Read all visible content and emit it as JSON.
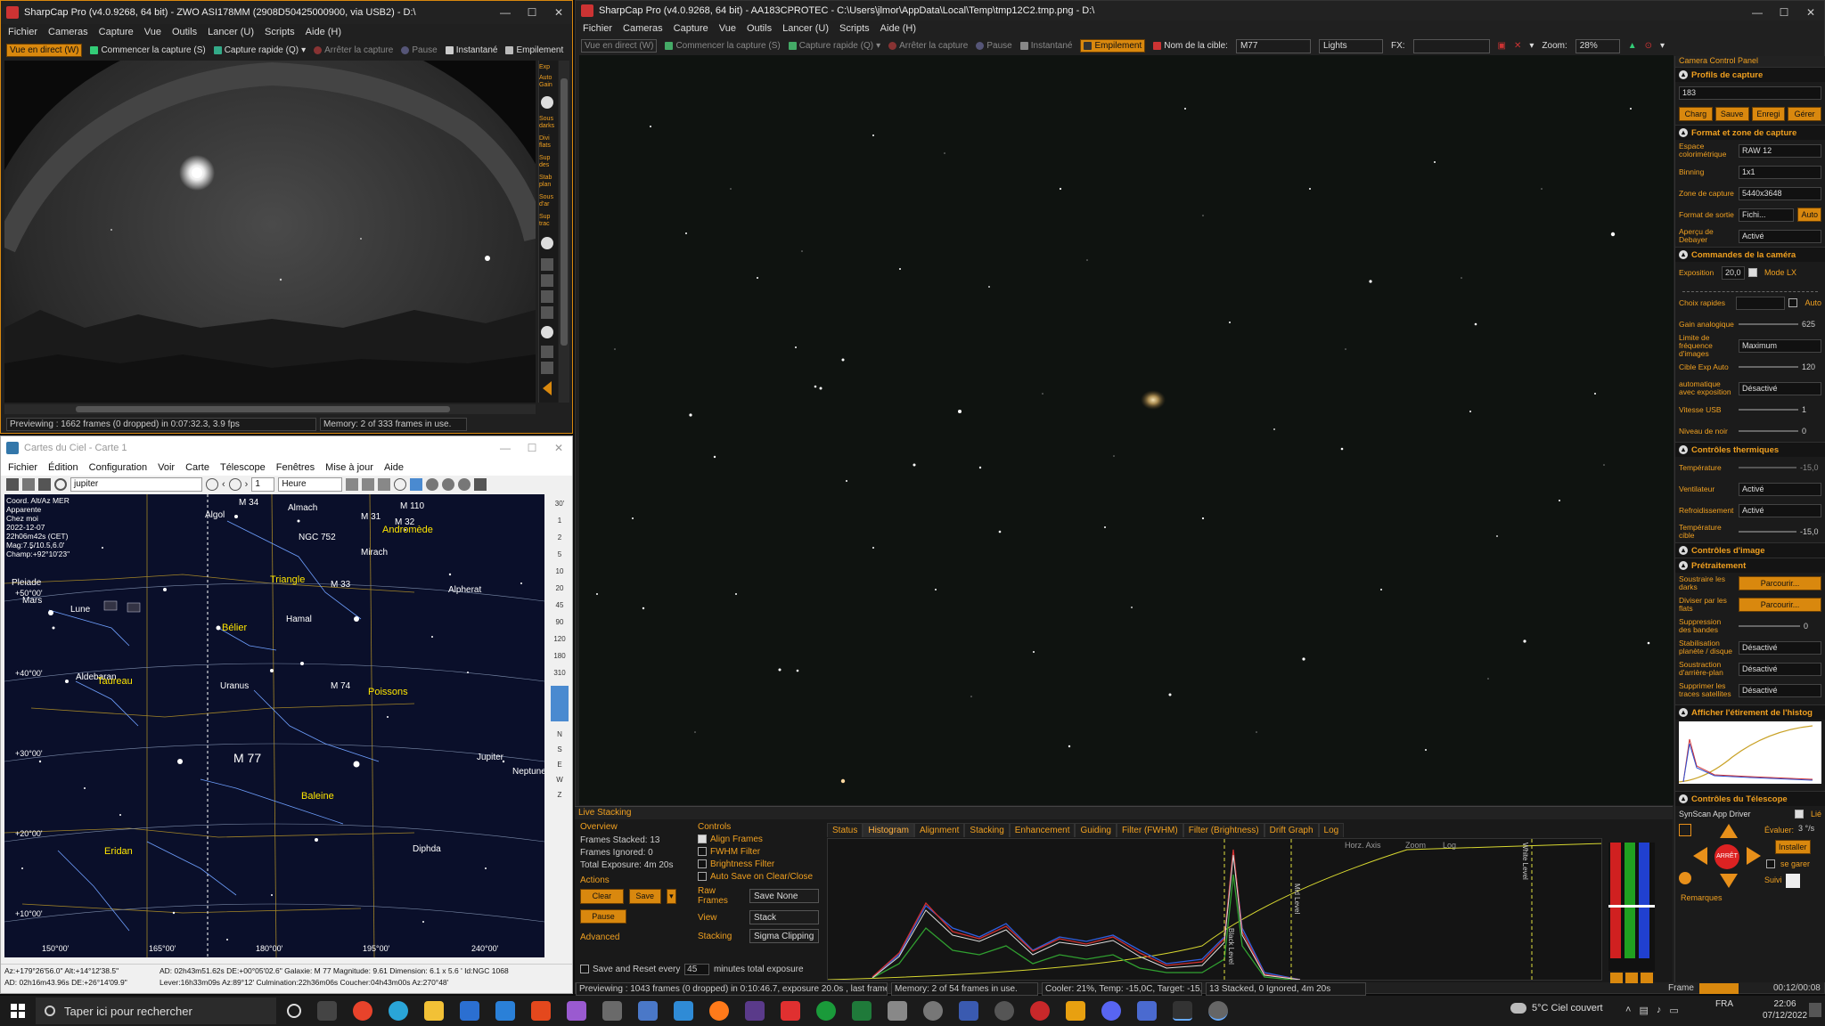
{
  "cam1": {
    "title": "SharpCap Pro (v4.0.9268, 64 bit) - ZWO ASI178MM (2908D50425000900, via USB2) - D:\\",
    "menu": [
      "Fichier",
      "Cameras",
      "Capture",
      "Vue",
      "Outils",
      "Lancer (U)",
      "Scripts",
      "Aide (H)"
    ],
    "toolbar": {
      "live": "Vue en direct (W)",
      "start": "Commencer la capture (S)",
      "quick": "Capture rapide (Q)",
      "stop": "Arrêter la capture",
      "pause": "Pause",
      "snap": "Instantané",
      "stack": "Empilement"
    },
    "side_labels": [
      "Exp",
      "Auto Gain",
      "Sous darks",
      "Divi flats",
      "Sup des",
      "Stab plan",
      "Sous d'ar",
      "Sup trac"
    ],
    "status_preview": "Previewing : 1662 frames (0 dropped) in 0:07:32.3, 3.9 fps",
    "status_memory": "Memory: 2 of 333 frames in use."
  },
  "cam2": {
    "title": "SharpCap Pro (v4.0.9268, 64 bit) - AA183CPROTEC - C:\\Users\\jlmor\\AppData\\Local\\Temp\\tmp12C2.tmp.png - D:\\",
    "menu": [
      "Fichier",
      "Cameras",
      "Capture",
      "Vue",
      "Outils",
      "Lancer (U)",
      "Scripts",
      "Aide (H)"
    ],
    "toolbar": {
      "live": "Vue en direct (W)",
      "start": "Commencer la capture (S)",
      "quick": "Capture rapide (Q)",
      "stop": "Arrêter la capture",
      "pause": "Pause",
      "snap": "Instantané",
      "stack": "Empilement",
      "target_label": "Nom de la cible:",
      "target": "M77",
      "frame_type": "Lights",
      "fx_label": "FX:",
      "zoom_label": "Zoom:",
      "zoom": "28%"
    },
    "status_preview": "Previewing : 1043 frames (0 dropped) in 0:10:46.7, exposure 20.0s , last frame 20.3",
    "status_memory": "Memory: 2 of 54 frames in use.",
    "status_cooler": "Cooler: 21%, Temp: -15,0C, Target: -15,0C",
    "status_stack": "13 Stacked, 0 Ignored, 4m 20s",
    "frame_label": "Frame",
    "frame_time": "00:12/00:08"
  },
  "panel": {
    "header": "Camera Control Panel",
    "profiles": {
      "title": "Profils de capture",
      "value": "183",
      "buttons": [
        "Charg",
        "Sauve",
        "Enregi",
        "Gérer"
      ]
    },
    "format": {
      "title": "Format et zone de capture",
      "rows": [
        {
          "label": "Espace colorimétrique",
          "value": "RAW 12"
        },
        {
          "label": "Binning",
          "value": "1x1"
        },
        {
          "label": "Zone de capture",
          "value": "5440x3648"
        },
        {
          "label": "Format de sortie",
          "value": "Fichi...",
          "extra": "Auto"
        },
        {
          "label": "Aperçu de Debayer",
          "value": "Activé"
        }
      ]
    },
    "camera": {
      "title": "Commandes de la caméra",
      "exposure_label": "Exposition",
      "exposure": "20,0",
      "mode_lx": "Mode LX",
      "quick_label": "Choix rapides",
      "auto": "Auto",
      "rows": [
        {
          "label": "Gain analogique",
          "value": "625"
        },
        {
          "label": "Limite de fréquence d'images",
          "value": "Maximum"
        },
        {
          "label": "Cible Exp Auto",
          "value": "120"
        },
        {
          "label": "automatique avec exposition",
          "value": "Désactivé"
        },
        {
          "label": "Vitesse USB",
          "value": "1"
        },
        {
          "label": "Niveau de noir",
          "value": "0"
        }
      ]
    },
    "thermal": {
      "title": "Contrôles thermiques",
      "rows": [
        {
          "label": "Température",
          "value": "-15,0"
        },
        {
          "label": "Ventilateur",
          "value": "Activé"
        },
        {
          "label": "Refroidissement",
          "value": "Activé"
        },
        {
          "label": "Température cible",
          "value": "-15,0"
        }
      ]
    },
    "image": {
      "title": "Contrôles d'image"
    },
    "preprocess": {
      "title": "Prétraitement",
      "rows": [
        {
          "label": "Soustraire les darks",
          "value": "Parcourir..."
        },
        {
          "label": "Diviser par les flats",
          "value": "Parcourir..."
        },
        {
          "label": "Suppression des bandes",
          "value": "0"
        },
        {
          "label": "Stabilisation planète / disque",
          "value": "Désactivé"
        },
        {
          "label": "Soustraction d'arrière-plan",
          "value": "Désactivé"
        },
        {
          "label": "Supprimer les traces satellites",
          "value": "Désactivé"
        }
      ]
    },
    "histo": {
      "title": "Afficher l'étirement de l'histog"
    },
    "telescope": {
      "title": "Contrôles du Télescope",
      "driver": "SynScan App Driver",
      "lie": "Lié",
      "eval_label": "Évaluer:",
      "eval": "3 °/s",
      "install": "Installer",
      "park": "se garer",
      "follow": "Suivi",
      "remarks": "Remarques",
      "stop": "ARRÊT"
    }
  },
  "live": {
    "title": "Live Stacking",
    "overview": "Overview",
    "stacked": "Frames Stacked: 13",
    "ignored": "Frames Ignored: 0",
    "total": "Total Exposure: 4m 20s",
    "actions": "Actions",
    "clear": "Clear",
    "save": "Save",
    "pause": "Pause",
    "advanced": "Advanced",
    "save_reset": "Save and Reset every",
    "minutes": "45",
    "minutes_label": "minutes total exposure",
    "controls": "Controls",
    "align": "Align Frames",
    "fwhm": "FWHM Filter",
    "bright": "Brightness Filter",
    "autosave": "Auto Save on Clear/Close",
    "raw_label": "Raw Frames",
    "raw": "Save None",
    "view_label": "View",
    "view": "Stack",
    "stacking_label": "Stacking",
    "stacking": "Sigma Clipping",
    "tabs": [
      "Status",
      "Histogram",
      "Alignment",
      "Stacking",
      "Enhancement",
      "Guiding",
      "Filter (FWHM)",
      "Filter (Brightness)",
      "Drift Graph",
      "Log"
    ],
    "hist_horz": "Horz. Axis",
    "hist_zoom": "Zoom",
    "hist_log": "Log",
    "black_level": "Black Level",
    "mid_level": "Mid Level",
    "white_level": "White Level"
  },
  "cdc": {
    "title": "Cartes du Ciel - Carte 1",
    "menu": [
      "Fichier",
      "Édition",
      "Configuration",
      "Voir",
      "Carte",
      "Télescope",
      "Fenêtres",
      "Mise à jour",
      "Aide"
    ],
    "search": "jupiter",
    "step": "1",
    "unit": "Heure",
    "info": [
      "Coord. Alt/Az MER",
      "Apparente",
      "Chez moi",
      "2022-12-07",
      "22h06m42s (CET)",
      "Mag:7.5/10.5,6.0'",
      "Champ:+92°10'23\""
    ],
    "objects": [
      "M 34",
      "Almach",
      "M 110",
      "M 31",
      "M 32",
      "Algol",
      "Andromède",
      "NGC 752",
      "Mirach",
      "Triangle",
      "M 33",
      "Alpherat",
      "Hamal",
      "Bélier",
      "Mars",
      "Lune",
      "Aldebaran",
      "Taureau",
      "Uranus",
      "M 74",
      "Poissons",
      "M 77",
      "Jupiter",
      "Neptune",
      "Baleine",
      "Eridan",
      "Diphda",
      "Pleiade"
    ],
    "dec_labels": [
      "+50°00'",
      "+40°00'",
      "+30°00'",
      "+20°00'",
      "+10°00'"
    ],
    "ra_labels": [
      "150°00'",
      "165°00'",
      "180°00'",
      "195°00'",
      "240°00'"
    ],
    "status1": "Az:+179°26'56.0\" Alt:+14°12'38.5\"",
    "status2": "AD: 02h16m43.96s DE:+26°14'09.9\"",
    "status3": "AD: 02h43m51.62s DE:+00°05'02.6\"  Galaxie: M 77  Magnitude: 9.61  Dimension: 6.1 x 5.6 ' Id:NGC 1068",
    "status4": "Lever:16h33m09s Az:89°12' Culmination:22h36m06s Coucher:04h43m00s Az:270°48'"
  },
  "taskbar": {
    "search": "Taper ici pour rechercher",
    "weather": "5°C  Ciel couvert",
    "lang": "FRA",
    "time": "22:06",
    "date": "07/12/2022"
  }
}
